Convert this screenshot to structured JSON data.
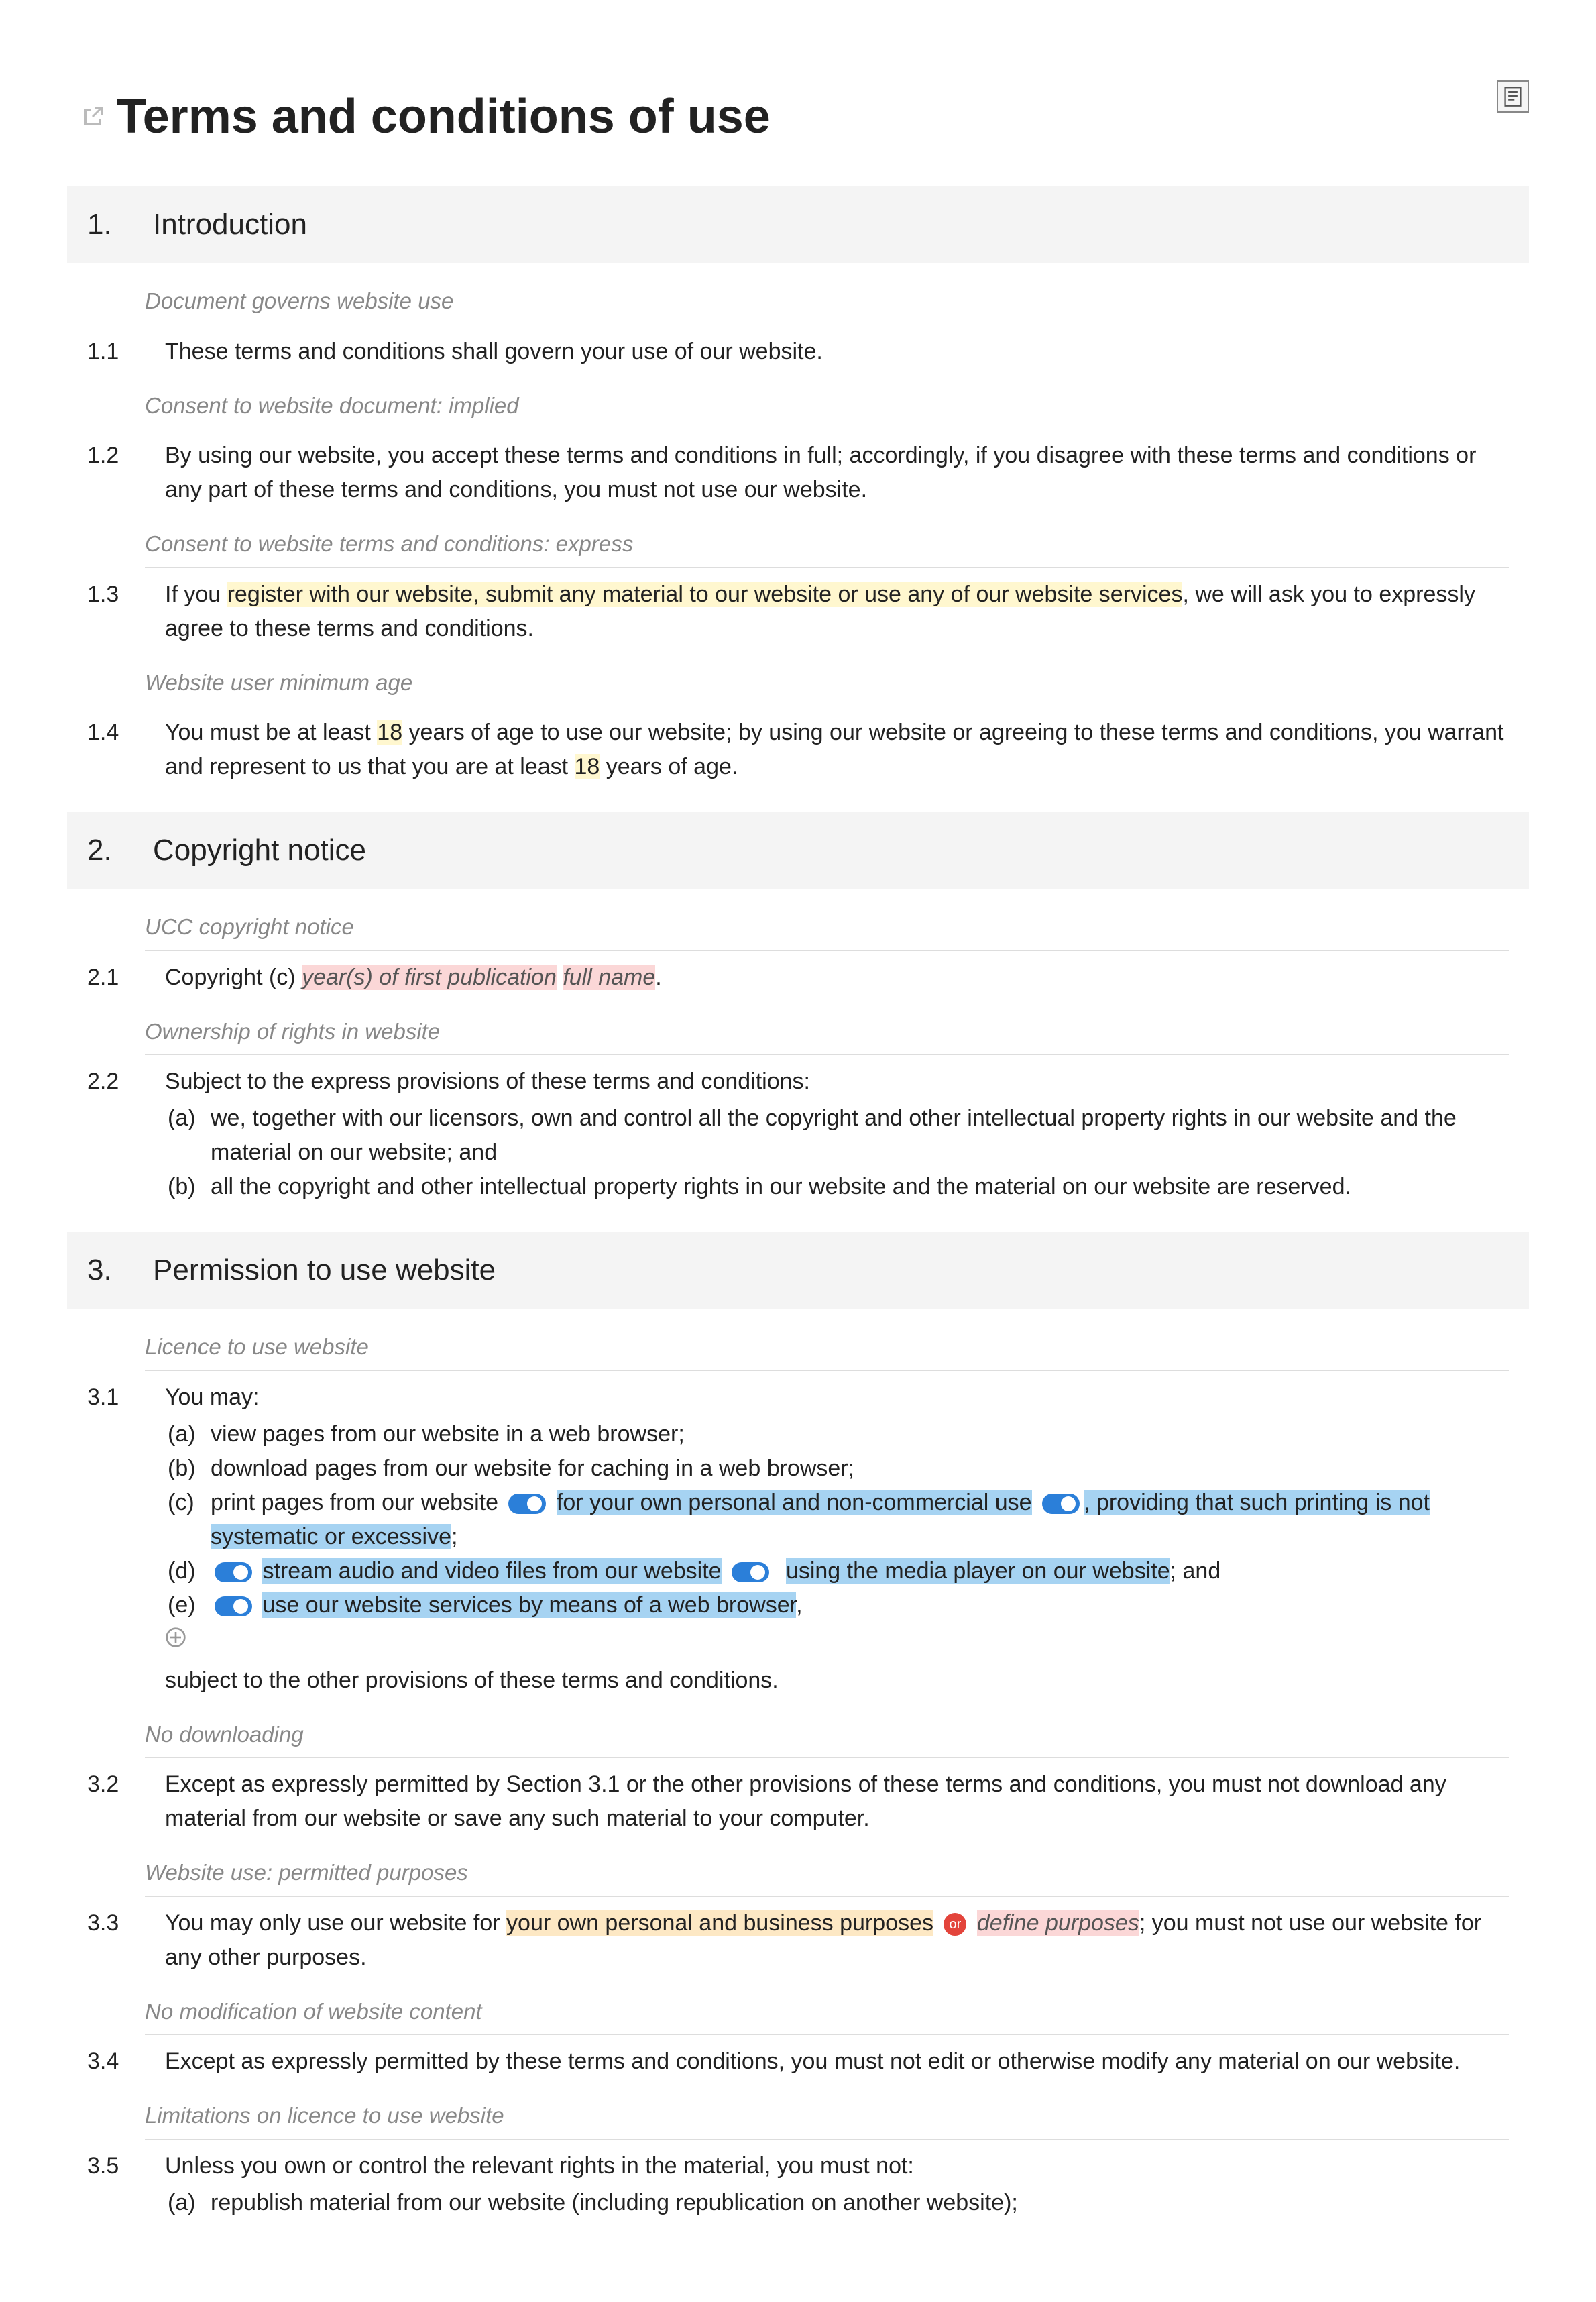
{
  "title": "Terms and conditions of use",
  "sections": [
    {
      "num": "1.",
      "title": "Introduction",
      "clauses": [
        {
          "annotation": "Document governs website use",
          "num": "1.1",
          "body_html": "These terms and conditions shall govern your use of our website."
        },
        {
          "annotation": "Consent to website document: implied",
          "num": "1.2",
          "body_html": "By using our website, you accept these terms and conditions in full; accordingly, if you disagree with these terms and conditions or any part of these terms and conditions, you must not use our website."
        },
        {
          "annotation": "Consent to website terms and conditions: express",
          "num": "1.3",
          "body_html": "If you <span class='hl-yellow'>register with our website, submit any material to our website or use any of our website services</span>, we will ask you to expressly agree to these terms and conditions."
        },
        {
          "annotation": "Website user minimum age",
          "num": "1.4",
          "body_html": "You must be at least <span class='hl-yellow'>18</span> years of age to use our website; by using our website or agreeing to these terms and conditions, you warrant and represent to us that you are at least <span class='hl-yellow'>18</span> years of age."
        }
      ]
    },
    {
      "num": "2.",
      "title": "Copyright notice",
      "clauses": [
        {
          "annotation": "UCC copyright notice",
          "num": "2.1",
          "body_html": "Copyright (c) <span class='hl-red-italic'>year(s) of first publication</span> <span class='hl-red-italic'>full name</span>."
        },
        {
          "annotation": "Ownership of rights in website",
          "num": "2.2",
          "body_html": "Subject to the express provisions of these terms and conditions:",
          "subs": [
            {
              "letter": "(a)",
              "text": "we, together with our licensors, own and control all the copyright and other intellectual property rights in our website and the material on our website; and"
            },
            {
              "letter": "(b)",
              "text": "all the copyright and other intellectual property rights in our website and the material on our website are reserved."
            }
          ]
        }
      ]
    },
    {
      "num": "3.",
      "title": "Permission to use website",
      "clauses": [
        {
          "annotation": "Licence to use website",
          "num": "3.1",
          "body_html": "You may:",
          "subs": [
            {
              "letter": "(a)",
              "html": "view pages from our website in a web browser;"
            },
            {
              "letter": "(b)",
              "html": "download pages from our website for caching in a web browser;"
            },
            {
              "letter": "(c)",
              "html": "print pages from our website <span class='toggle' data-name='toggle-icon' data-interactable='true'></span> <span class='hl-blue'>for your own personal and non-commercial use</span> <span class='toggle' data-name='toggle-icon' data-interactable='true'></span><span class='hl-blue'>, providing that such printing is not systematic or excessive</span>;"
            },
            {
              "letter": "(d)",
              "html": "<span class='toggle' data-name='toggle-icon' data-interactable='true'></span> <span class='hl-blue'>stream audio and video files from our website</span> <span class='toggle' data-name='toggle-icon' data-interactable='true'></span> &nbsp;<span class='hl-blue'>using the media player on our website</span>; and"
            },
            {
              "letter": "(e)",
              "html": "<span class='toggle' data-name='toggle-icon' data-interactable='true'></span> <span class='hl-blue'>use our website services by means of a web browser</span>,"
            }
          ],
          "tail_html": "subject to the other provisions of these terms and conditions.",
          "show_cross": true
        },
        {
          "annotation": "No downloading",
          "num": "3.2",
          "body_html": "Except as expressly permitted by Section 3.1 or the other provisions of these terms and conditions, you must not download any material from our website or save any such material to your computer."
        },
        {
          "annotation": "Website use: permitted purposes",
          "num": "3.3",
          "body_html": "You may only use our website for <span class='hl-orange'>your own personal and business purposes</span> <span class='or-badge' data-name='or-badge' data-interactable='false'>or</span> <span class='hl-red-italic'>define purposes</span>; you must not use our website for any other purposes."
        },
        {
          "annotation": "No modification of website content",
          "num": "3.4",
          "body_html": "Except as expressly permitted by these terms and conditions, you must not edit or otherwise modify any material on our website."
        },
        {
          "annotation": "Limitations on licence to use website",
          "num": "3.5",
          "body_html": "Unless you own or control the relevant rights in the material, you must not:",
          "subs": [
            {
              "letter": "(a)",
              "text": "republish material from our website (including republication on another website);"
            }
          ]
        }
      ]
    }
  ]
}
